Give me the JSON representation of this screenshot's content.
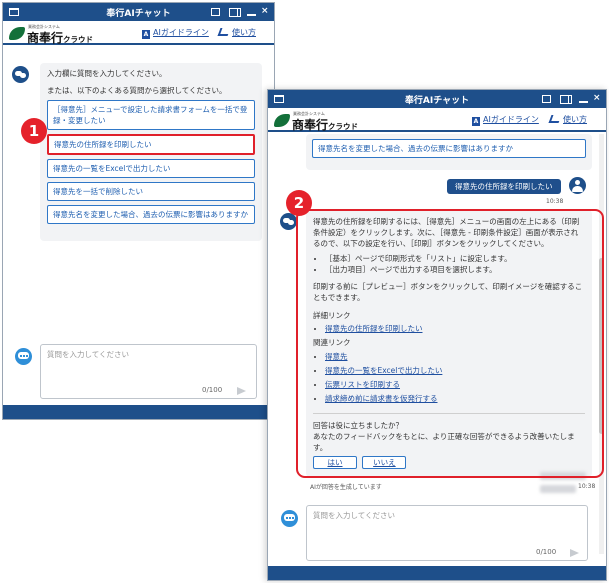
{
  "colors": {
    "titlebar": "#1e4f8a",
    "accent": "#2f77c7",
    "highlight": "#e0202a",
    "user_bubble": "#1f4f8c"
  },
  "window1": {
    "title": "奉行AIチャット",
    "logo_small": "業務会計システム",
    "logo_main": "商奉行",
    "logo_sub": "クラウド",
    "guide_link": "AIガイドライン",
    "howto_link": "使い方",
    "bot_intro_1": "入力欄に質問を入力してください。",
    "bot_intro_2": "または、以下のよくある質問から選択してください。",
    "suggestions": [
      "［得意先］メニューで設定した請求書フォームを一括で登録・変更したい",
      "得意先の住所録を印刷したい",
      "得意先の一覧をExcelで出力したい",
      "得意先を一括で削除したい",
      "得意先名を変更した場合、過去の伝票に影響はありますか"
    ],
    "input_placeholder": "質問を入力してください",
    "counter": "0/100",
    "step_label": "1"
  },
  "window2": {
    "title": "奉行AIチャット",
    "logo_small": "業務会計システム",
    "logo_main": "商奉行",
    "logo_sub": "クラウド",
    "guide_link": "AIガイドライン",
    "howto_link": "使い方",
    "prev_suggestion": "得意先名を変更した場合、過去の伝票に影響はありますか",
    "user_message": "得意先の住所録を印刷したい",
    "user_time": "10:38",
    "answer": {
      "intro": "得意先の住所録を印刷するには、［得意先］メニューの画面の左上にある（印刷条件設定）をクリックします。次に、［得意先 - 印刷条件設定］画面が表示されるので、以下の設定を行い、［印刷］ボタンをクリックしてください。",
      "bullets": [
        "［基本］ページで印刷形式を「リスト」に設定します。",
        "［出力項目］ページで出力する項目を選択します。"
      ],
      "note": "印刷する前に［プレビュー］ボタンをクリックして、印刷イメージを確認することもできます。",
      "detail_heading": "詳細リンク",
      "detail_links": [
        "得意先の住所録を印刷したい"
      ],
      "related_heading": "関連リンク",
      "related_links": [
        "得意先",
        "得意先の一覧をExcelで出力したい",
        "伝票リストを印刷する",
        "請求締め前に請求書を仮発行する"
      ],
      "feedback_q": "回答は役に立ちましたか？",
      "feedback_note": "あなたのフィードバックをもとに、より正確な回答ができるよう改善いたします。",
      "yes": "はい",
      "no": "いいえ"
    },
    "answer_time": "10:38",
    "ai_status": "AIが回答を生成しています",
    "input_placeholder": "質問を入力してください",
    "counter": "0/100",
    "step_label": "2"
  }
}
